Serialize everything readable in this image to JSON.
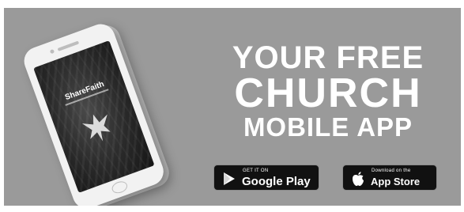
{
  "banner": {
    "background_color": "#9a9a9a",
    "headline": {
      "line1": "YOUR FREE",
      "line2": "CHURCH",
      "line3": "MOBILE APP"
    }
  },
  "phone": {
    "app_name": "ShareFaith",
    "icons": {
      "logo": "dove-icon"
    }
  },
  "badges": {
    "google_play": {
      "small_text": "GET IT ON",
      "big_text": "Google Play",
      "icon": "google-play-icon"
    },
    "app_store": {
      "small_text": "Download on the",
      "big_text": "App Store",
      "icon": "apple-icon"
    }
  }
}
